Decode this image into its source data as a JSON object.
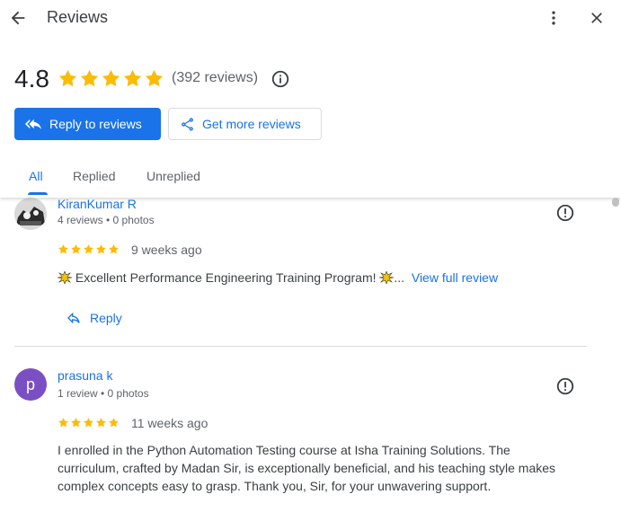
{
  "header": {
    "title": "Reviews",
    "rating": "4.8",
    "star_count": 5,
    "review_count": "(392 reviews)",
    "reply_button_label": "Reply to reviews",
    "get_more_label": "Get more reviews"
  },
  "tabs": [
    {
      "label": "All",
      "active": true
    },
    {
      "label": "Replied",
      "active": false
    },
    {
      "label": "Unreplied",
      "active": false
    }
  ],
  "reviews": [
    {
      "name": "KiranKumar R",
      "meta": "4 reviews • 0 photos",
      "stars": 5,
      "date": "9 weeks ago",
      "text": "Excellent Performance Engineering Training Program!",
      "ellipsis": "...",
      "view_full_label": "View full review",
      "reply_label": "Reply"
    },
    {
      "name": "prasuna k",
      "avatar_letter": "p",
      "meta": "1 review • 0 photos",
      "stars": 5,
      "date": "11 weeks ago",
      "text_lines": [
        "I enrolled in the Python Automation Testing course at Isha Training Solutions. The",
        "curriculum, crafted by Madan Sir, is exceptionally beneficial, and his teaching style makes",
        "complex concepts easy to grasp. Thank you, Sir, for your unwavering support."
      ]
    }
  ],
  "colors": {
    "accent": "#1a73e8",
    "star": "#fbbc04",
    "avatar_purple": "#7b4fc4"
  }
}
